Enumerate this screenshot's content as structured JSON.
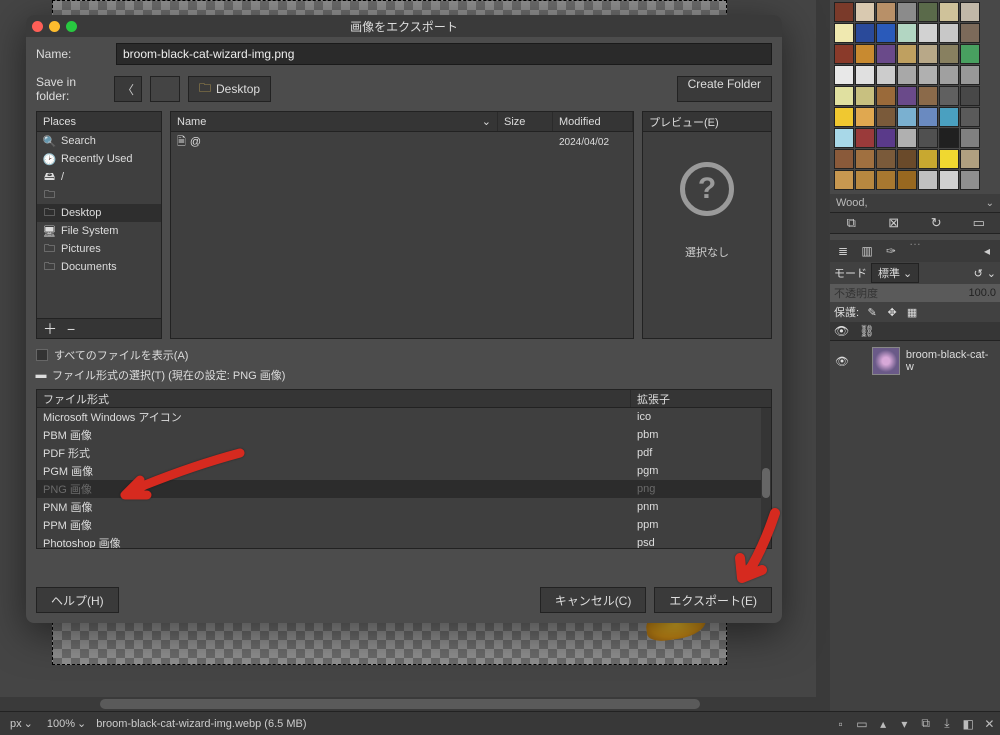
{
  "dialog": {
    "title": "画像をエクスポート",
    "name_label": "Name:",
    "name_value": "broom-black-cat-wizard-img.png",
    "savein_label": "Save in folder:",
    "back_icon": "chevron-left",
    "crumb_icon": "folder",
    "crumb_label": "Desktop",
    "create_folder": "Create Folder",
    "places_header": "Places",
    "places": [
      {
        "icon": "search",
        "label": "Search"
      },
      {
        "icon": "recent",
        "label": "Recently Used"
      },
      {
        "icon": "disk",
        "label": "/"
      },
      {
        "icon": "folder",
        "label": ""
      },
      {
        "icon": "folder",
        "label": "Desktop",
        "selected": true
      },
      {
        "icon": "fs",
        "label": "File System"
      },
      {
        "icon": "folder",
        "label": "Pictures"
      },
      {
        "icon": "folder",
        "label": "Documents"
      }
    ],
    "places_add": "＋",
    "places_remove": "−",
    "files_headers": {
      "name": "Name",
      "size": "Size",
      "modified": "Modified"
    },
    "files": [
      {
        "icon": "file",
        "name": "@",
        "size": "",
        "modified": "2024/04/02"
      }
    ],
    "preview_header": "プレビュー(E)",
    "preview_none": "選択なし",
    "show_all": "すべてのファイルを表示(A)",
    "file_type_select": "ファイル形式の選択(T) (現在の設定: PNG 画像)",
    "ft_headers": {
      "name": "ファイル形式",
      "ext": "拡張子"
    },
    "filetypes": [
      {
        "name": "Microsoft Windows アイコン",
        "ext": "ico"
      },
      {
        "name": "PBM 画像",
        "ext": "pbm"
      },
      {
        "name": "PDF 形式",
        "ext": "pdf"
      },
      {
        "name": "PGM 画像",
        "ext": "pgm"
      },
      {
        "name": "PNG 画像",
        "ext": "png",
        "selected": true
      },
      {
        "name": "PNM 画像",
        "ext": "pnm"
      },
      {
        "name": "PPM 画像",
        "ext": "ppm"
      },
      {
        "name": "Photoshop 画像",
        "ext": "psd"
      }
    ],
    "help_btn": "ヘルプ(H)",
    "cancel_btn": "キャンセル(C)",
    "export_btn": "エクスポート(E)"
  },
  "right": {
    "swatch_label": "Wood,",
    "mode_label": "モード",
    "mode_value": "標準",
    "opacity_label": "不透明度",
    "opacity_value": "100.0",
    "lock_label": "保護:",
    "layer_name": "broom-black-cat-w"
  },
  "status": {
    "unit": "px",
    "zoom": "100%",
    "file": "broom-black-cat-wizard-img.webp (6.5 MB)"
  },
  "swatch_colors": [
    "#7a3a2a",
    "#d9c9b0",
    "#b89068",
    "#8b8b8b",
    "#5a6a4a",
    "#cfc29a",
    "#c2b8a8",
    "#f0e9b0",
    "#2a4a9a",
    "#2a5aba",
    "#b2d6c2",
    "#d2d2d2",
    "#c8c8c8",
    "#7c6a5a",
    "#8a3a2a",
    "#c88a30",
    "#6a4a8a",
    "#bfa060",
    "#b8a888",
    "#888060",
    "#48a060",
    "#e8e8e8",
    "#e0e0e0",
    "#cccccc",
    "#a8a8a8",
    "#b0b0b0",
    "#a0a0a0",
    "#989898",
    "#e0e0a0",
    "#c8c080",
    "#9a6a3a",
    "#6a4a8a",
    "#8b6a4a",
    "#606060",
    "#484848",
    "#f0c830",
    "#e0a850",
    "#7a5a3a",
    "#7ab0d0",
    "#6a8ac0",
    "#4aa0c0",
    "#5a5a5a",
    "#a8d8e8",
    "#9a3a3a",
    "#5a3a8a",
    "#b0b0b0",
    "#505050",
    "#202020",
    "#808080",
    "#8a5a3a",
    "#a07040",
    "#7a5a3a",
    "#6a4a2a",
    "#c8a830",
    "#f0d830",
    "#b0a080",
    "#c89850",
    "#b88840",
    "#a87830",
    "#986820",
    "#c0c0c0",
    "#d0d0d0",
    "#909090"
  ]
}
